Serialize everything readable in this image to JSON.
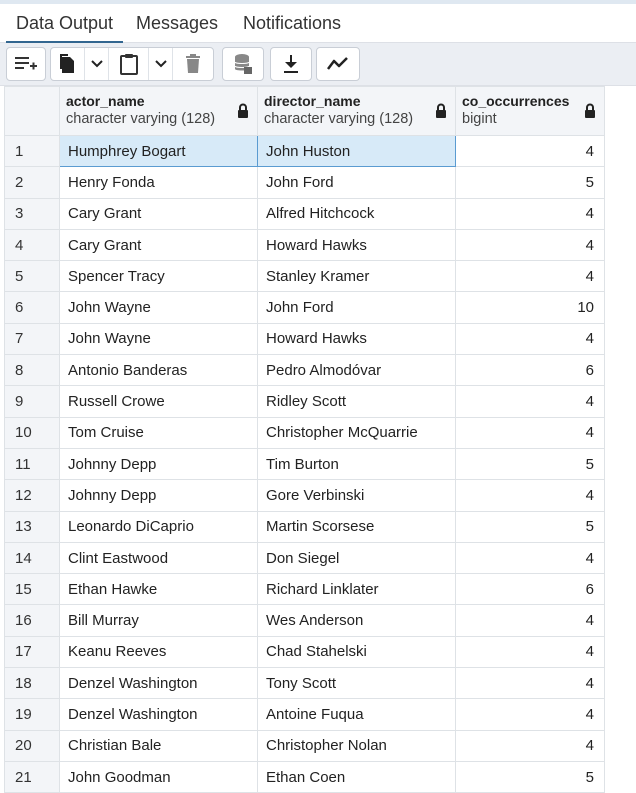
{
  "tabs": [
    {
      "label": "Data Output",
      "active": true
    },
    {
      "label": "Messages",
      "active": false
    },
    {
      "label": "Notifications",
      "active": false
    }
  ],
  "toolbar": {
    "icons": [
      "add-row-icon",
      "copy-icon",
      "chevron-down-icon",
      "paste-icon",
      "chevron-down-icon",
      "delete-icon",
      "save-data-icon",
      "download-icon",
      "graph-visualiser-icon"
    ]
  },
  "grid": {
    "columns": [
      {
        "name": "actor_name",
        "type": "character varying (128)"
      },
      {
        "name": "director_name",
        "type": "character varying (128)"
      },
      {
        "name": "co_occurrences",
        "type": "bigint"
      }
    ],
    "rows": [
      {
        "n": "1",
        "actor": "Humphrey Bogart",
        "director": "John Huston",
        "count": "4"
      },
      {
        "n": "2",
        "actor": "Henry Fonda",
        "director": "John Ford",
        "count": "5"
      },
      {
        "n": "3",
        "actor": "Cary Grant",
        "director": "Alfred Hitchcock",
        "count": "4"
      },
      {
        "n": "4",
        "actor": "Cary Grant",
        "director": "Howard Hawks",
        "count": "4"
      },
      {
        "n": "5",
        "actor": "Spencer Tracy",
        "director": "Stanley Kramer",
        "count": "4"
      },
      {
        "n": "6",
        "actor": "John Wayne",
        "director": "John Ford",
        "count": "10"
      },
      {
        "n": "7",
        "actor": "John Wayne",
        "director": "Howard Hawks",
        "count": "4"
      },
      {
        "n": "8",
        "actor": "Antonio Banderas",
        "director": "Pedro Almodóvar",
        "count": "6"
      },
      {
        "n": "9",
        "actor": "Russell Crowe",
        "director": "Ridley Scott",
        "count": "4"
      },
      {
        "n": "10",
        "actor": "Tom Cruise",
        "director": "Christopher McQuarrie",
        "count": "4"
      },
      {
        "n": "11",
        "actor": "Johnny Depp",
        "director": "Tim Burton",
        "count": "5"
      },
      {
        "n": "12",
        "actor": "Johnny Depp",
        "director": "Gore Verbinski",
        "count": "4"
      },
      {
        "n": "13",
        "actor": "Leonardo DiCaprio",
        "director": "Martin Scorsese",
        "count": "5"
      },
      {
        "n": "14",
        "actor": "Clint Eastwood",
        "director": "Don Siegel",
        "count": "4"
      },
      {
        "n": "15",
        "actor": "Ethan Hawke",
        "director": "Richard Linklater",
        "count": "6"
      },
      {
        "n": "16",
        "actor": "Bill Murray",
        "director": "Wes Anderson",
        "count": "4"
      },
      {
        "n": "17",
        "actor": "Keanu Reeves",
        "director": "Chad Stahelski",
        "count": "4"
      },
      {
        "n": "18",
        "actor": "Denzel Washington",
        "director": "Tony Scott",
        "count": "4"
      },
      {
        "n": "19",
        "actor": "Denzel Washington",
        "director": "Antoine Fuqua",
        "count": "4"
      },
      {
        "n": "20",
        "actor": "Christian Bale",
        "director": "Christopher Nolan",
        "count": "4"
      },
      {
        "n": "21",
        "actor": "John Goodman",
        "director": "Ethan Coen",
        "count": "5"
      }
    ]
  }
}
